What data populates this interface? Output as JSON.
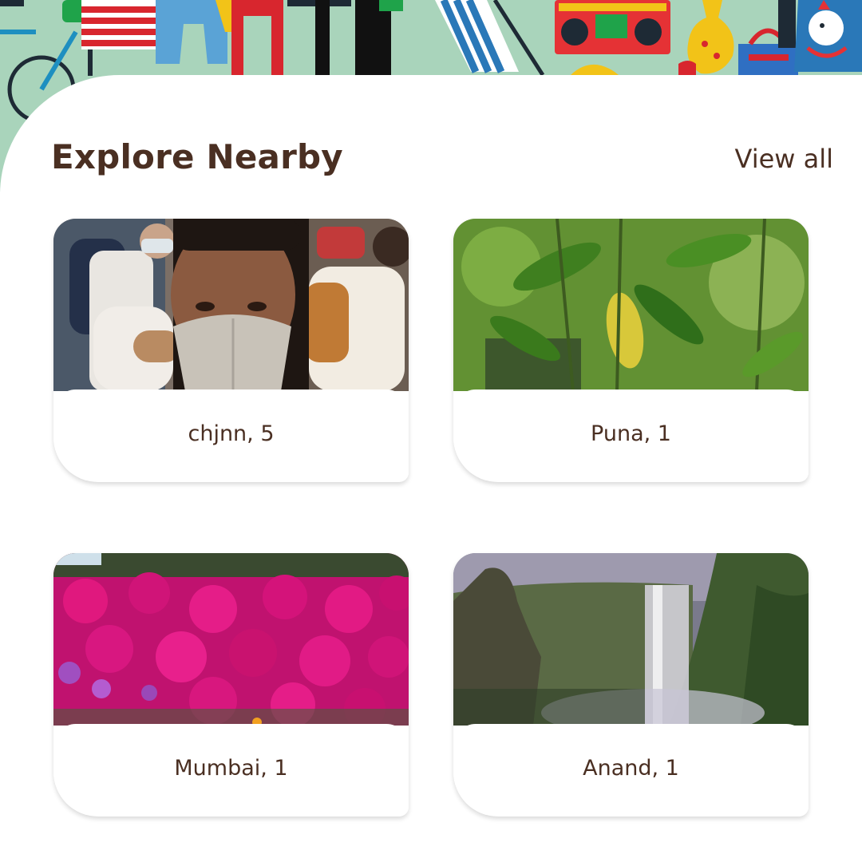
{
  "header": {
    "title": "Explore Nearby",
    "view_all_label": "View all"
  },
  "cards": [
    {
      "label": "chjnn, 5",
      "image": "selfie-with-mask-crowd-photo"
    },
    {
      "label": "Puna, 1",
      "image": "green-leaves-photo"
    },
    {
      "label": "Mumbai, 1",
      "image": "pink-flowers-photo"
    },
    {
      "label": "Anand, 1",
      "image": "waterfall-photo"
    }
  ],
  "colors": {
    "text_brown": "#4a2f22",
    "banner_green": "#a9d4bb"
  }
}
